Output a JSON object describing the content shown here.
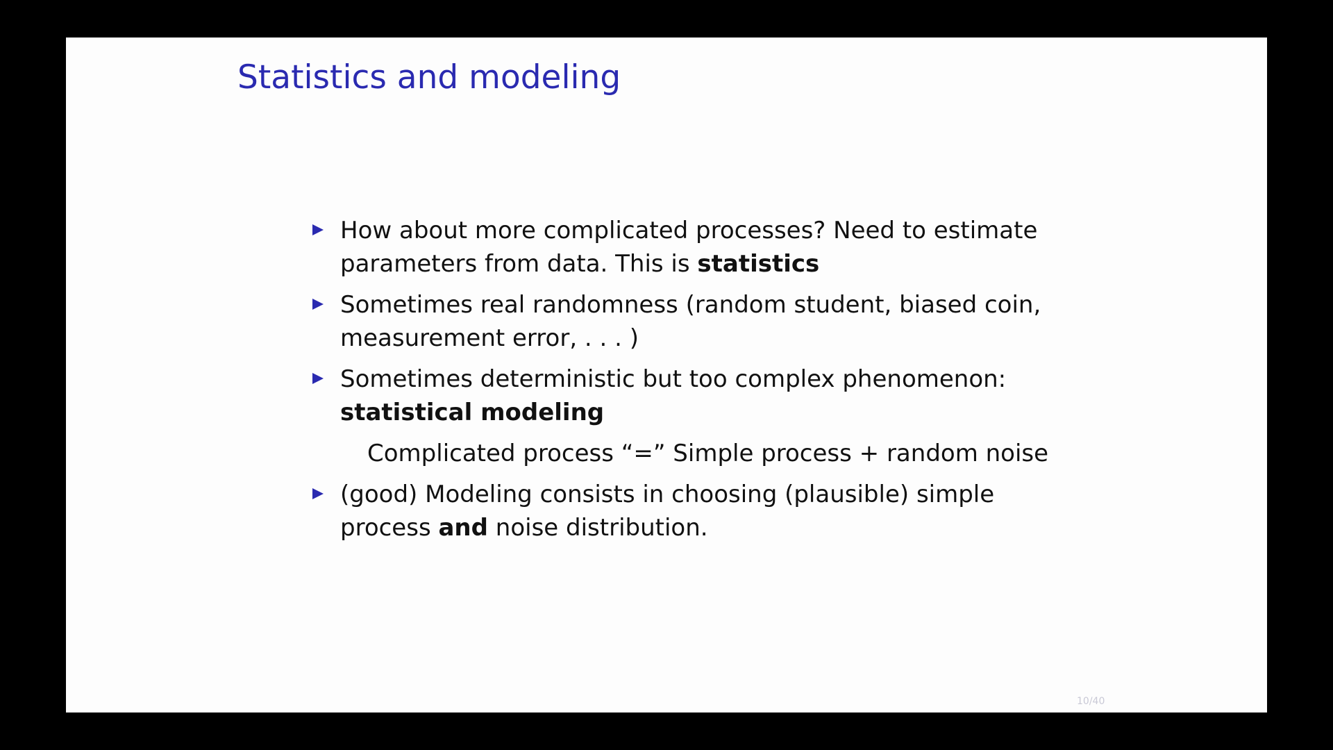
{
  "slide": {
    "title": "Statistics and modeling",
    "page_number": "10/40",
    "bullets": [
      {
        "text_before": "How about more complicated processes? Need to estimate parameters from data.  This is ",
        "bold": "statistics",
        "text_after": ""
      },
      {
        "text_before": "Sometimes real randomness (random student, biased coin, measurement error, . . . )",
        "bold": "",
        "text_after": ""
      },
      {
        "text_before": "Sometimes deterministic but too complex phenomenon: ",
        "bold": "statistical modeling",
        "text_after": ""
      },
      {
        "text_before": "(good) Modeling consists in choosing (plausible) simple process ",
        "bold": "and",
        "text_after": " noise distribution."
      }
    ],
    "equation": "Complicated process “=” Simple process + random noise",
    "colors": {
      "accent": "#2a2ab0",
      "background": "#fdfdfd",
      "frame": "#000000"
    },
    "bullet_icon": "triangle-right-icon"
  }
}
